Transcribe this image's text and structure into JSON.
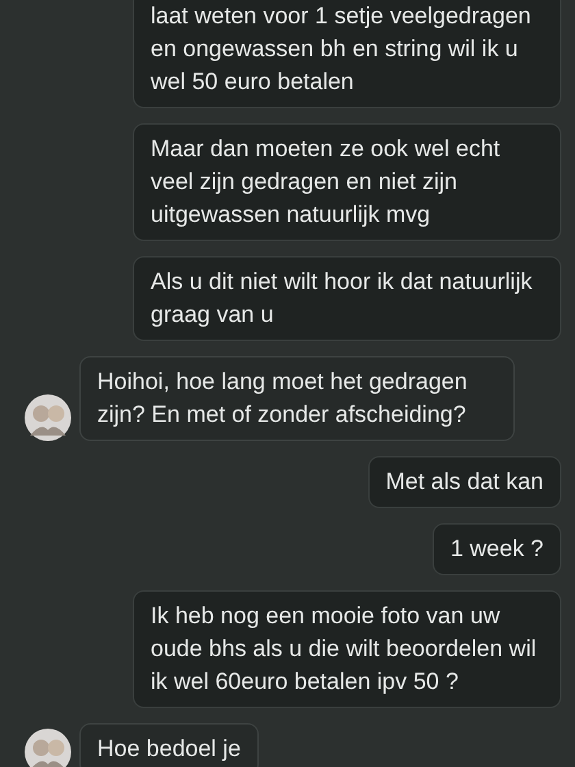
{
  "messages": [
    {
      "kind": "sent",
      "text": "laat weten voor 1 setje veelgedragen en ongewassen bh en string wil ik u wel 50 euro betalen"
    },
    {
      "kind": "sent",
      "text": "Maar dan moeten ze ook wel echt veel zijn gedragen en niet zijn uitgewassen natuurlijk mvg"
    },
    {
      "kind": "sent",
      "text": "Als u dit niet wilt hoor ik dat natuurlijk graag van u"
    },
    {
      "kind": "received",
      "text": "Hoihoi, hoe lang moet het gedragen zijn? En met of zonder afscheiding?"
    },
    {
      "kind": "sent",
      "text": "Met als dat kan"
    },
    {
      "kind": "sent",
      "text": "1 week ?"
    },
    {
      "kind": "sent",
      "text": "Ik heb nog een mooie foto van uw oude bhs als u die wilt beoordelen wil ik wel 60euro betalen ipv 50 ?"
    },
    {
      "kind": "received",
      "text": "Hoe bedoel je"
    }
  ]
}
